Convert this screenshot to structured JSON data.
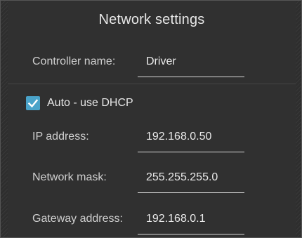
{
  "title": "Network settings",
  "controller": {
    "label": "Controller name:",
    "value": "Driver"
  },
  "dhcp": {
    "label": "Auto - use DHCP",
    "checked": true
  },
  "ip": {
    "label": "IP address:",
    "value": "192.168.0.50"
  },
  "mask": {
    "label": "Network mask:",
    "value": "255.255.255.0"
  },
  "gateway": {
    "label": "Gateway address:",
    "value": "192.168.0.1"
  },
  "colors": {
    "panel": "#303030",
    "accent": "#4aa3c9",
    "text": "#e6e6e6"
  }
}
